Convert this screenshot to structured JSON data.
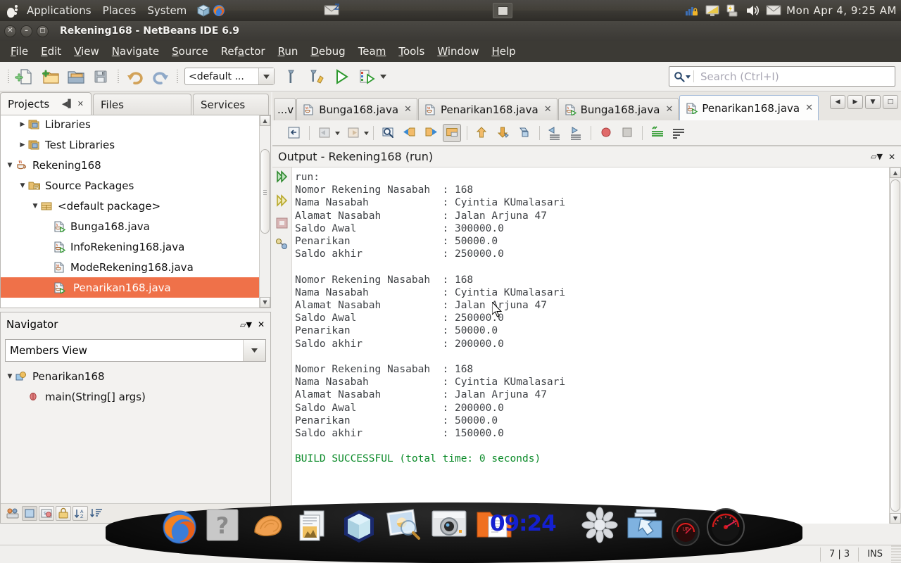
{
  "gnome_panel": {
    "menus": [
      "Applications",
      "Places",
      "System"
    ],
    "launchers": [
      "package-icon",
      "firefox-icon"
    ],
    "tray_left": [
      "mail-icon"
    ],
    "tray_icons": [
      "network-lock-icon",
      "display-icon",
      "battery-icon",
      "volume-icon",
      "mail-icon"
    ],
    "clock": "Mon Apr  4,  9:25 AM"
  },
  "window": {
    "title": "Rekening168 - NetBeans IDE 6.9",
    "buttons": [
      "close",
      "minimize",
      "maximize"
    ]
  },
  "menubar": {
    "items": [
      {
        "label": "File",
        "mnemonic": "F"
      },
      {
        "label": "Edit",
        "mnemonic": "E"
      },
      {
        "label": "View",
        "mnemonic": "V"
      },
      {
        "label": "Navigate",
        "mnemonic": "N"
      },
      {
        "label": "Source",
        "mnemonic": "S"
      },
      {
        "label": "Refactor",
        "mnemonic": "a"
      },
      {
        "label": "Run",
        "mnemonic": "R"
      },
      {
        "label": "Debug",
        "mnemonic": "D"
      },
      {
        "label": "Team",
        "mnemonic": "m"
      },
      {
        "label": "Tools",
        "mnemonic": "T"
      },
      {
        "label": "Window",
        "mnemonic": "W"
      },
      {
        "label": "Help",
        "mnemonic": "H"
      }
    ]
  },
  "toolbar": {
    "icons": [
      "new-file-icon",
      "new-project-icon",
      "open-project-icon",
      "save-all-icon",
      "undo-icon",
      "redo-icon"
    ],
    "config_value": "<default ...",
    "build_icons": [
      "build-project-icon",
      "clean-and-build-icon",
      "run-project-icon",
      "debug-project-icon"
    ],
    "search_placeholder": "Search (Ctrl+I)",
    "search_value": ""
  },
  "left_dock": {
    "tabs": [
      {
        "label": "Projects",
        "active": true
      },
      {
        "label": "Files",
        "active": false
      },
      {
        "label": "Services",
        "active": false
      }
    ],
    "tree": [
      {
        "label": "Libraries",
        "indent": 2,
        "twist": "collapsed",
        "icon": "libraries-icon",
        "selected": false
      },
      {
        "label": "Test Libraries",
        "indent": 2,
        "twist": "collapsed",
        "icon": "libraries-icon",
        "selected": false
      },
      {
        "label": "Rekening168",
        "indent": 1,
        "twist": "expanded",
        "icon": "java-project-icon",
        "selected": false
      },
      {
        "label": "Source Packages",
        "indent": 2,
        "twist": "expanded",
        "icon": "source-packages-icon",
        "selected": false
      },
      {
        "label": "<default package>",
        "indent": 3,
        "twist": "expanded",
        "icon": "package-icon",
        "selected": false
      },
      {
        "label": "Bunga168.java",
        "indent": 4,
        "twist": "none",
        "icon": "java-main-file-icon",
        "selected": false
      },
      {
        "label": "InfoRekening168.java",
        "indent": 4,
        "twist": "none",
        "icon": "java-main-file-icon",
        "selected": false
      },
      {
        "label": "ModeRekening168.java",
        "indent": 4,
        "twist": "none",
        "icon": "java-file-icon",
        "selected": false
      },
      {
        "label": "Penarikan168.java",
        "indent": 4,
        "twist": "none",
        "icon": "java-main-file-icon",
        "selected": true
      }
    ]
  },
  "navigator": {
    "title": "Navigator",
    "view_selected": "Members View",
    "tree": [
      {
        "label": "Penarikan168",
        "indent": 1,
        "twist": "expanded",
        "icon": "class-icon"
      },
      {
        "label": "main(String[] args)",
        "indent": 2,
        "twist": "none",
        "icon": "method-icon"
      }
    ],
    "bottom_icons": [
      "inherited-members-icon",
      "show-fields-icon",
      "show-static-icon",
      "show-nonpublic-icon",
      "sort-alpha-icon",
      "sort-source-icon"
    ]
  },
  "editor": {
    "tabs": [
      {
        "label": "...v",
        "icon": "java-file-icon",
        "active": false,
        "closable": false
      },
      {
        "label": "Bunga168.java",
        "icon": "java-file-icon",
        "active": false,
        "closable": true
      },
      {
        "label": "Penarikan168.java",
        "icon": "java-file-icon",
        "active": false,
        "closable": true
      },
      {
        "label": "Bunga168.java",
        "icon": "java-main-file-icon",
        "active": false,
        "closable": true
      },
      {
        "label": "Penarikan168.java",
        "icon": "java-main-file-icon",
        "active": true,
        "closable": true
      }
    ],
    "tab_nav_buttons": [
      "scroll-left-icon",
      "scroll-right-icon",
      "tab-list-icon",
      "maximize-icon"
    ],
    "toolbar_icons": [
      "last-edit-icon",
      "back-icon",
      "forward-icon",
      "find-selection-icon",
      "previous-bookmark-icon",
      "next-bookmark-icon",
      "toggle-bookmark-icon",
      "previous-error-icon",
      "next-error-icon",
      "toggle-rectangular-icon",
      "shift-left-icon",
      "shift-right-icon",
      "toggle-breakpoint-icon",
      "stop-icon",
      "comment-icon",
      "uncomment-icon"
    ]
  },
  "output": {
    "title": "Output - Rekening168 (run)",
    "gutter_icons": [
      "run-icon",
      "rerun-icon",
      "stop-icon",
      "build-icon"
    ],
    "window_actions": [
      "minimize-icon",
      "close-icon"
    ],
    "lines": [
      {
        "text": "run:",
        "style": "normal"
      },
      {
        "text": "Nomor Rekening Nasabah  : 168",
        "style": "normal"
      },
      {
        "text": "Nama Nasabah            : Cyintia KUmalasari",
        "style": "normal"
      },
      {
        "text": "Alamat Nasabah          : Jalan Arjuna 47",
        "style": "normal"
      },
      {
        "text": "Saldo Awal              : 300000.0",
        "style": "normal"
      },
      {
        "text": "Penarikan               : 50000.0",
        "style": "normal"
      },
      {
        "text": "Saldo akhir             : 250000.0",
        "style": "normal"
      },
      {
        "text": "",
        "style": "normal"
      },
      {
        "text": "Nomor Rekening Nasabah  : 168",
        "style": "normal"
      },
      {
        "text": "Nama Nasabah            : Cyintia KUmalasari",
        "style": "normal"
      },
      {
        "text": "Alamat Nasabah          : Jalan Arjuna 47",
        "style": "normal"
      },
      {
        "text": "Saldo Awal              : 250000.0",
        "style": "normal"
      },
      {
        "text": "Penarikan               : 50000.0",
        "style": "normal"
      },
      {
        "text": "Saldo akhir             : 200000.0",
        "style": "normal"
      },
      {
        "text": "",
        "style": "normal"
      },
      {
        "text": "Nomor Rekening Nasabah  : 168",
        "style": "normal"
      },
      {
        "text": "Nama Nasabah            : Cyintia KUmalasari",
        "style": "normal"
      },
      {
        "text": "Alamat Nasabah          : Jalan Arjuna 47",
        "style": "normal"
      },
      {
        "text": "Saldo Awal              : 200000.0",
        "style": "normal"
      },
      {
        "text": "Penarikan               : 50000.0",
        "style": "normal"
      },
      {
        "text": "Saldo akhir             : 150000.0",
        "style": "normal"
      },
      {
        "text": "",
        "style": "normal"
      },
      {
        "text": "BUILD SUCCESSFUL (total time: 0 seconds)",
        "style": "success"
      }
    ]
  },
  "statusbar": {
    "position": "7 | 3",
    "insert_mode": "INS"
  },
  "dock": {
    "clock": "09:24",
    "icons": [
      "firefox-icon",
      "help-icon",
      "shell-icon",
      "document-viewer-icon",
      "virtualbox-icon",
      "image-viewer-icon",
      "camera-icon",
      "file-manager-icon",
      "screenlets-icon",
      "updater-icon",
      "system-monitor-small-icon",
      "system-monitor-icon"
    ]
  },
  "colors": {
    "selection": "#ef7149",
    "success": "#0a8a28",
    "panel_bg": "#3c3a35",
    "clock_blue": "#1420d0"
  }
}
